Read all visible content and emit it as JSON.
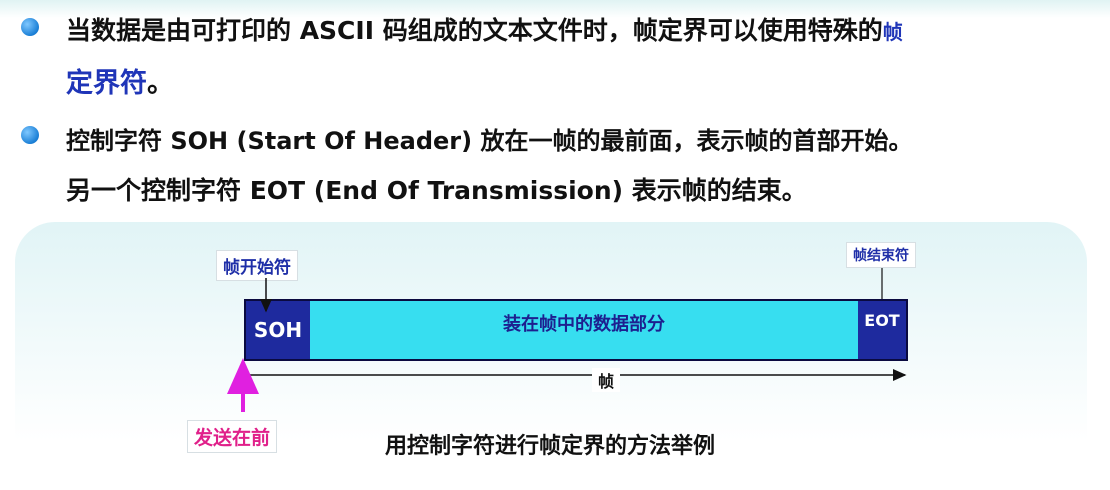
{
  "bullets": [
    {
      "line1": "当数据是由可打印的 ASCII 码组成的文本文件时，帧定界可以使用特殊的",
      "line1_accent": "帧",
      "line2_accent": "定界符",
      "line2_rest": "。"
    },
    {
      "line1": "控制字符 SOH (Start Of Header) 放在一帧的最前面，表示帧的首部开始。",
      "line2": "另一个控制字符 EOT (End Of Transmission) 表示帧的结束。"
    }
  ],
  "diagram": {
    "start_label": "帧开始符",
    "end_label": "帧结束符",
    "soh": "SOH",
    "eot": "EOT",
    "payload": "装在帧中的数据部分",
    "frame": "帧",
    "send_first": "发送在前",
    "caption": "用控制字符进行帧定界的方法举例"
  },
  "colors": {
    "accent": "#1f35b8",
    "control_char_bg": "#1e2a9e",
    "payload_bg": "#37def0",
    "send_arrow": "#e020e0",
    "bullet": "#1a7fd6"
  }
}
